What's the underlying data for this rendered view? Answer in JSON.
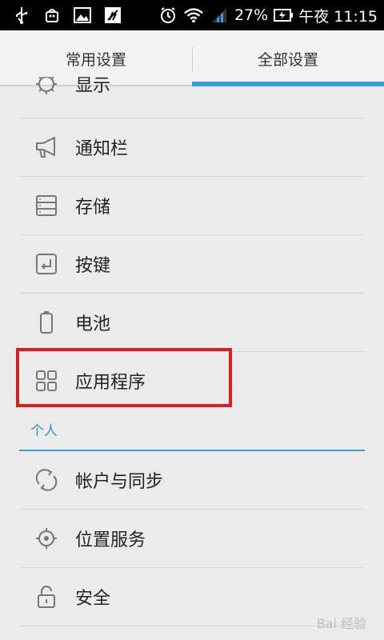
{
  "status_bar": {
    "battery": "27%",
    "time": "午夜 11:15",
    "icons": [
      "usb-icon",
      "android-icon",
      "image-icon",
      "sail-icon",
      "alarm-icon",
      "wifi-icon",
      "signal-icon",
      "battery-icon"
    ]
  },
  "tabs": {
    "common": "常用设置",
    "all": "全部设置"
  },
  "settings": {
    "items": [
      {
        "label": "显示",
        "icon": "display-icon"
      },
      {
        "label": "通知栏",
        "icon": "megaphone-icon"
      },
      {
        "label": "存储",
        "icon": "storage-icon"
      },
      {
        "label": "按键",
        "icon": "key-icon"
      },
      {
        "label": "电池",
        "icon": "battery-icon"
      },
      {
        "label": "应用程序",
        "icon": "apps-icon"
      }
    ],
    "personal_section": "个人",
    "personal_items": [
      {
        "label": "帐户与同步",
        "icon": "sync-icon"
      },
      {
        "label": "位置服务",
        "icon": "location-icon"
      },
      {
        "label": "安全",
        "icon": "lock-icon"
      }
    ]
  },
  "colors": {
    "accent": "#3a9bdc",
    "highlight": "#d9201f"
  },
  "watermark": "Bai 经验"
}
